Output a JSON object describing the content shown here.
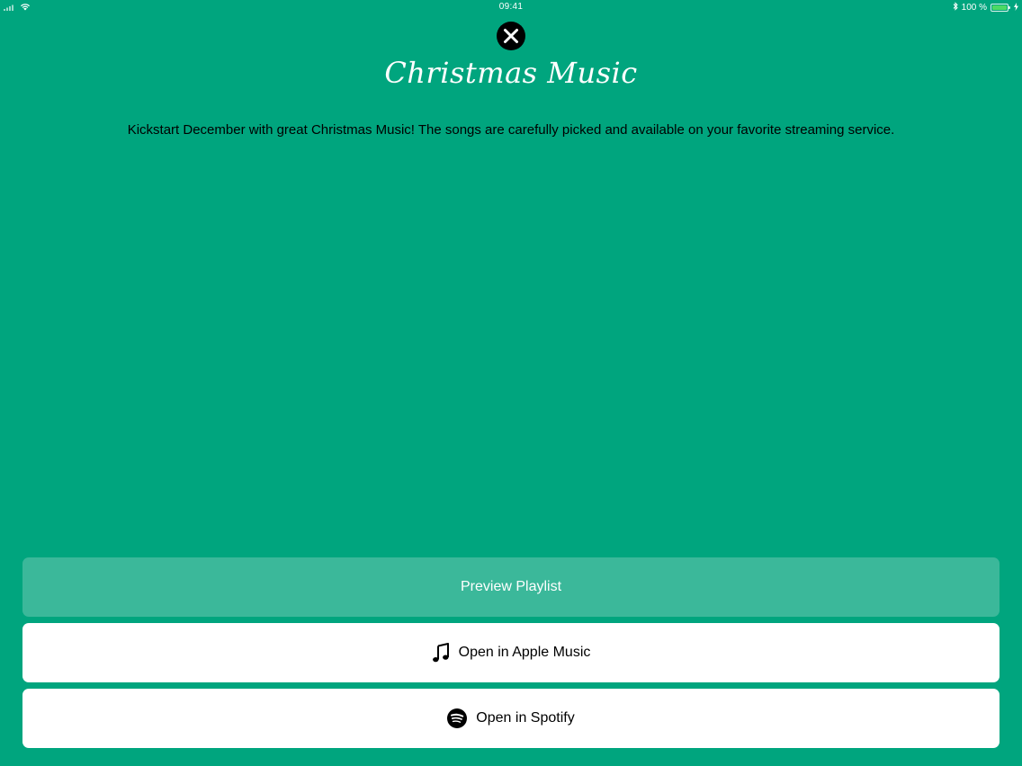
{
  "status_bar": {
    "time": "09:41",
    "battery_text": "100 %",
    "battery_level": 1.0,
    "icons": [
      "signal-icon",
      "wifi-icon",
      "bluetooth-icon",
      "battery-icon",
      "charging-icon"
    ]
  },
  "close_button": {
    "icon": "close-icon"
  },
  "title": "Christmas Music",
  "description": "Kickstart December with great Christmas Music! The songs are carefully picked and available on your favorite streaming service.",
  "buttons": {
    "preview_label": "Preview Playlist",
    "apple_music_label": "Open in Apple Music",
    "apple_music_icon": "music-note-icon",
    "spotify_label": "Open in Spotify",
    "spotify_icon": "spotify-icon"
  },
  "colors": {
    "background": "#00a57e",
    "preview_button": "#3bb89a",
    "action_button": "#ffffff"
  }
}
